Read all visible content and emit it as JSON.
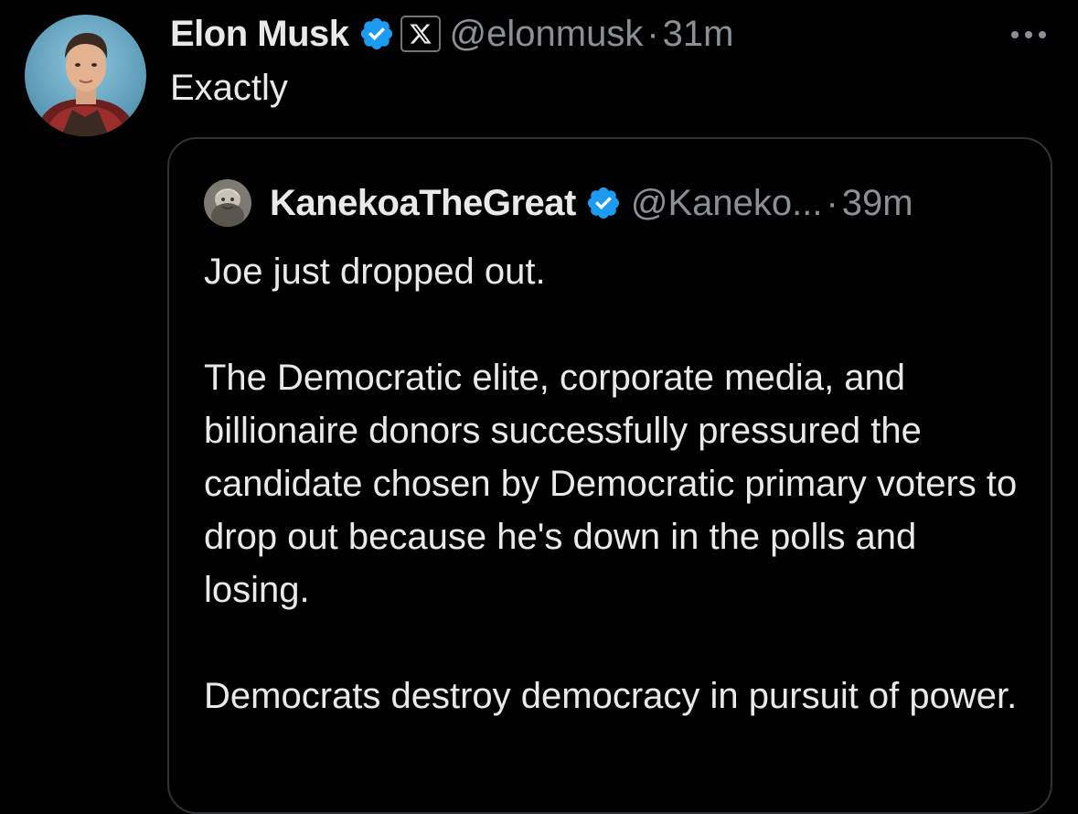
{
  "tweet": {
    "author": {
      "display_name": "Elon Musk",
      "handle": "@elonmusk",
      "verified_icon": "verified-badge-icon",
      "affiliate_icon": "x-logo-icon"
    },
    "dot": "·",
    "time": "31m",
    "more_icon": "more-options-icon",
    "text": "Exactly",
    "colors": {
      "background": "#000000",
      "primary_text": "#e7e9ea",
      "secondary_text": "#8b9096",
      "verified_blue": "#1d9bf0",
      "card_border": "#2f3336"
    }
  },
  "quote": {
    "author": {
      "display_name": "KanekoaTheGreat",
      "handle": "@Kaneko...",
      "verified_icon": "verified-badge-icon"
    },
    "dot": "·",
    "time": "39m",
    "paragraphs": [
      "Joe just dropped out.",
      "The Democratic elite, corporate media, and billionaire donors successfully pressured the candidate chosen by Democratic primary voters to drop out because he's down in the polls and losing.",
      "Democrats destroy democracy in pursuit of power."
    ]
  }
}
